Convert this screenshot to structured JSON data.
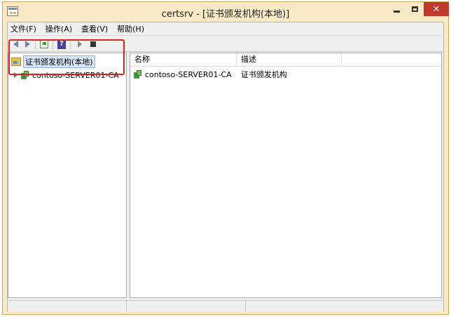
{
  "window": {
    "title": "certsrv - [证书颁发机构(本地)]",
    "close_label": "✕"
  },
  "menubar": {
    "items": [
      "文件(F)",
      "操作(A)",
      "查看(V)",
      "帮助(H)"
    ]
  },
  "toolbar": {
    "icons": [
      "back-arrow-icon",
      "forward-arrow-icon",
      "export-list-icon",
      "help-icon",
      "start-service-icon",
      "stop-service-icon"
    ],
    "help_label": "?"
  },
  "tree": {
    "root_label": "证书颁发机构(本地)",
    "child_label": "contoso-SERVER01-CA"
  },
  "list": {
    "columns": [
      "名称",
      "描述"
    ],
    "rows": [
      {
        "name": "contoso-SERVER01-CA",
        "description": "证书颁发机构"
      }
    ]
  },
  "colors": {
    "window_frame": "#f9e9c4",
    "close_button": "#c0392b",
    "highlight_box": "#e02020",
    "selection": "#d7e6f6"
  }
}
